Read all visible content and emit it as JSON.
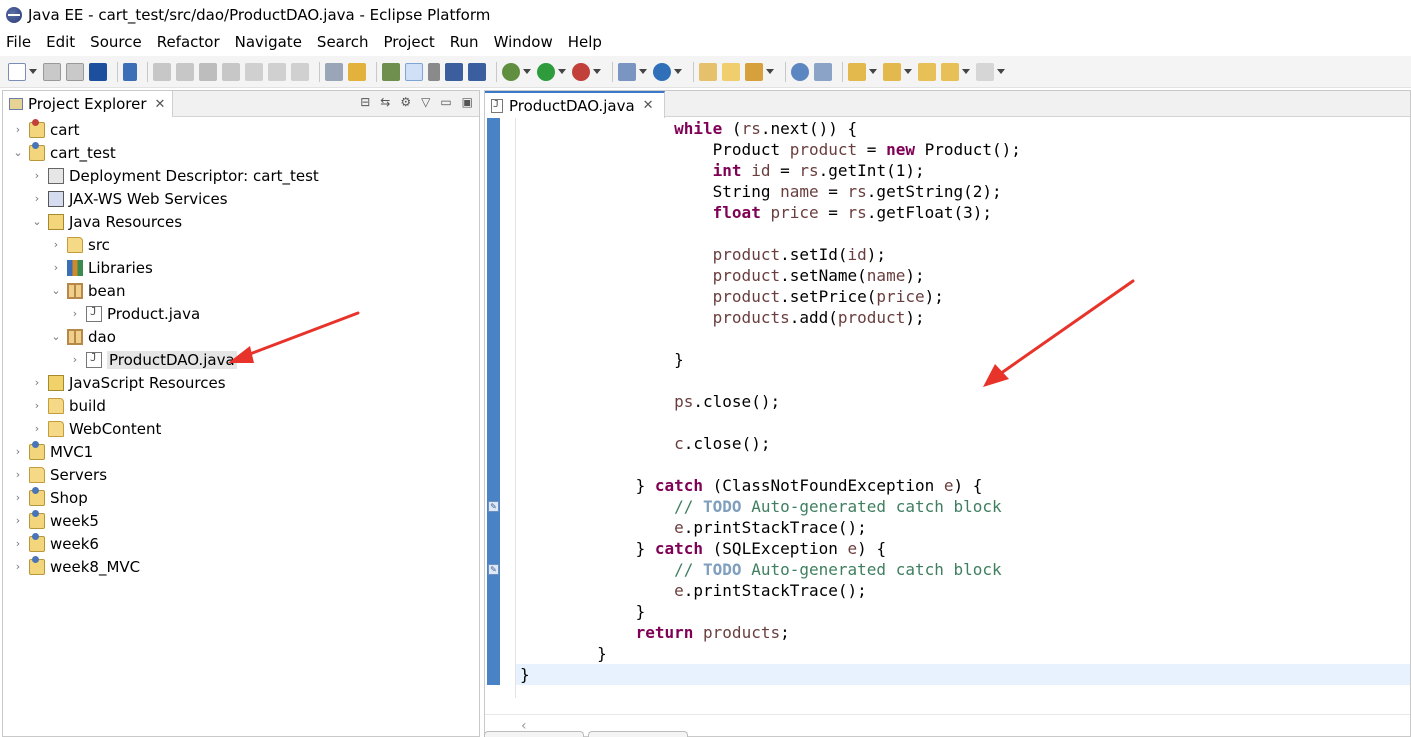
{
  "window": {
    "title": "Java EE - cart_test/src/dao/ProductDAO.java - Eclipse Platform"
  },
  "menubar": [
    "File",
    "Edit",
    "Source",
    "Refactor",
    "Navigate",
    "Search",
    "Project",
    "Run",
    "Window",
    "Help"
  ],
  "explorer": {
    "tab_label": "Project Explorer",
    "tree": [
      {
        "label": "cart",
        "depth": 0,
        "expanded": false,
        "icon": "project-icon"
      },
      {
        "label": "cart_test",
        "depth": 0,
        "expanded": true,
        "icon": "project-icon"
      },
      {
        "label": "Deployment Descriptor: cart_test",
        "depth": 1,
        "expanded": false,
        "icon": "deployment-descriptor-icon"
      },
      {
        "label": "JAX-WS Web Services",
        "depth": 1,
        "expanded": false,
        "icon": "web-services-icon"
      },
      {
        "label": "Java Resources",
        "depth": 1,
        "expanded": true,
        "icon": "java-resources-icon"
      },
      {
        "label": "src",
        "depth": 2,
        "expanded": false,
        "icon": "source-folder-icon"
      },
      {
        "label": "Libraries",
        "depth": 2,
        "expanded": false,
        "icon": "libraries-icon"
      },
      {
        "label": "bean",
        "depth": 2,
        "expanded": true,
        "icon": "package-icon"
      },
      {
        "label": "Product.java",
        "depth": 3,
        "expanded": false,
        "icon": "java-file-icon"
      },
      {
        "label": "dao",
        "depth": 2,
        "expanded": true,
        "icon": "package-icon"
      },
      {
        "label": "ProductDAO.java",
        "depth": 3,
        "expanded": false,
        "icon": "java-file-icon",
        "selected": true
      },
      {
        "label": "JavaScript Resources",
        "depth": 1,
        "expanded": false,
        "icon": "javascript-resources-icon"
      },
      {
        "label": "build",
        "depth": 1,
        "expanded": false,
        "icon": "folder-icon"
      },
      {
        "label": "WebContent",
        "depth": 1,
        "expanded": false,
        "icon": "folder-icon"
      },
      {
        "label": "MVC1",
        "depth": 0,
        "expanded": false,
        "icon": "project-icon"
      },
      {
        "label": "Servers",
        "depth": 0,
        "expanded": false,
        "icon": "folder-icon"
      },
      {
        "label": "Shop",
        "depth": 0,
        "expanded": false,
        "icon": "project-icon"
      },
      {
        "label": "week5",
        "depth": 0,
        "expanded": false,
        "icon": "project-icon"
      },
      {
        "label": "week6",
        "depth": 0,
        "expanded": false,
        "icon": "project-icon"
      },
      {
        "label": "week8_MVC",
        "depth": 0,
        "expanded": false,
        "icon": "project-icon"
      }
    ]
  },
  "editor": {
    "tab_label": "ProductDAO.java",
    "code_lines": [
      [
        [
          "                ",
          ""
        ],
        [
          "while",
          "kw"
        ],
        [
          " (",
          ""
        ],
        [
          "rs",
          "var"
        ],
        [
          ".next()) {",
          ""
        ]
      ],
      [
        [
          "                    Product ",
          ""
        ],
        [
          "product",
          "var"
        ],
        [
          " = ",
          ""
        ],
        [
          "new",
          "kw"
        ],
        [
          " Product();",
          ""
        ]
      ],
      [
        [
          "                    ",
          ""
        ],
        [
          "int",
          "kw"
        ],
        [
          " ",
          ""
        ],
        [
          "id",
          "var"
        ],
        [
          " = ",
          ""
        ],
        [
          "rs",
          "var"
        ],
        [
          ".getInt(1);",
          ""
        ]
      ],
      [
        [
          "                    String ",
          ""
        ],
        [
          "name",
          "var"
        ],
        [
          " = ",
          ""
        ],
        [
          "rs",
          "var"
        ],
        [
          ".getString(2);",
          ""
        ]
      ],
      [
        [
          "                    ",
          ""
        ],
        [
          "float",
          "kw"
        ],
        [
          " ",
          ""
        ],
        [
          "price",
          "var"
        ],
        [
          " = ",
          ""
        ],
        [
          "rs",
          "var"
        ],
        [
          ".getFloat(3);",
          ""
        ]
      ],
      [
        [
          "",
          ""
        ]
      ],
      [
        [
          "                    ",
          ""
        ],
        [
          "product",
          "var"
        ],
        [
          ".setId(",
          ""
        ],
        [
          "id",
          "var"
        ],
        [
          ");",
          ""
        ]
      ],
      [
        [
          "                    ",
          ""
        ],
        [
          "product",
          "var"
        ],
        [
          ".setName(",
          ""
        ],
        [
          "name",
          "var"
        ],
        [
          ");",
          ""
        ]
      ],
      [
        [
          "                    ",
          ""
        ],
        [
          "product",
          "var"
        ],
        [
          ".setPrice(",
          ""
        ],
        [
          "price",
          "var"
        ],
        [
          ");",
          ""
        ]
      ],
      [
        [
          "                    ",
          ""
        ],
        [
          "products",
          "var"
        ],
        [
          ".add(",
          ""
        ],
        [
          "product",
          "var"
        ],
        [
          ");",
          ""
        ]
      ],
      [
        [
          "",
          ""
        ]
      ],
      [
        [
          "                }",
          ""
        ]
      ],
      [
        [
          "",
          ""
        ]
      ],
      [
        [
          "                ",
          ""
        ],
        [
          "ps",
          "var"
        ],
        [
          ".close();",
          ""
        ]
      ],
      [
        [
          "",
          ""
        ]
      ],
      [
        [
          "                ",
          ""
        ],
        [
          "c",
          "var"
        ],
        [
          ".close();",
          ""
        ]
      ],
      [
        [
          "",
          ""
        ]
      ],
      [
        [
          "            } ",
          ""
        ],
        [
          "catch",
          "kw"
        ],
        [
          " (ClassNotFoundException ",
          ""
        ],
        [
          "e",
          "var"
        ],
        [
          ") {",
          ""
        ]
      ],
      [
        [
          "                ",
          ""
        ],
        [
          "// ",
          "cmt"
        ],
        [
          "TODO",
          "todo"
        ],
        [
          " Auto-generated catch block",
          "cmt"
        ]
      ],
      [
        [
          "                ",
          ""
        ],
        [
          "e",
          "var"
        ],
        [
          ".printStackTrace();",
          ""
        ]
      ],
      [
        [
          "            } ",
          ""
        ],
        [
          "catch",
          "kw"
        ],
        [
          " (SQLException ",
          ""
        ],
        [
          "e",
          "var"
        ],
        [
          ") {",
          ""
        ]
      ],
      [
        [
          "                ",
          ""
        ],
        [
          "// ",
          "cmt"
        ],
        [
          "TODO",
          "todo"
        ],
        [
          " Auto-generated catch block",
          "cmt"
        ]
      ],
      [
        [
          "                ",
          ""
        ],
        [
          "e",
          "var"
        ],
        [
          ".printStackTrace();",
          ""
        ]
      ],
      [
        [
          "            }",
          ""
        ]
      ],
      [
        [
          "            ",
          ""
        ],
        [
          "return",
          "kw"
        ],
        [
          " ",
          ""
        ],
        [
          "products",
          "var"
        ],
        [
          ";",
          ""
        ]
      ],
      [
        [
          "        }",
          ""
        ]
      ],
      [
        [
          "}",
          ""
        ]
      ]
    ]
  },
  "colors": {
    "keyword": "#7f0055",
    "variable": "#6a3e3e",
    "comment": "#3f7f5f",
    "todo": "#7f9fbf",
    "annotation_arrow": "#e8332a"
  }
}
